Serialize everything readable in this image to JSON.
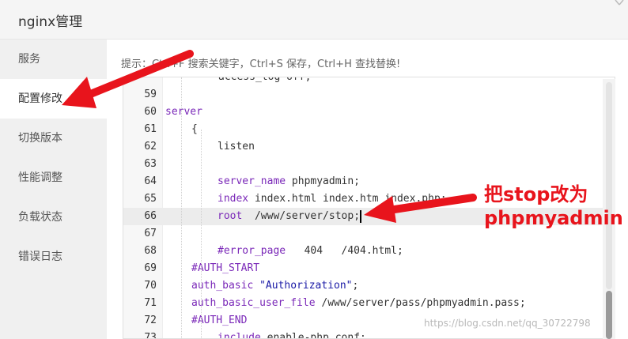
{
  "window": {
    "title": "nginx管理",
    "close_glyph": "⌐"
  },
  "sidebar": {
    "items": [
      {
        "label": "服务"
      },
      {
        "label": "配置修改"
      },
      {
        "label": "切换版本"
      },
      {
        "label": "性能调整"
      },
      {
        "label": "负载状态"
      },
      {
        "label": "错误日志"
      }
    ],
    "active_index": 1
  },
  "hint": "提示：Ctrl+F 搜索关键字，Ctrl+S 保存，Ctrl+H 查找替换!",
  "editor": {
    "partial_top_line": "access_log off;",
    "lines": [
      {
        "n": "59",
        "code": ""
      },
      {
        "n": "60",
        "code": "server"
      },
      {
        "n": "61",
        "code": "{"
      },
      {
        "n": "62",
        "code": "listen"
      },
      {
        "n": "63",
        "code": ""
      },
      {
        "n": "64",
        "code_kw": "server_name",
        "code_rest": " phpmyadmin;"
      },
      {
        "n": "65",
        "code_kw": "index",
        "code_rest": " index.html index.htm index.php;"
      },
      {
        "n": "66",
        "code_kw": "root",
        "code_rest": "  /www/server/stop;"
      },
      {
        "n": "67",
        "code": ""
      },
      {
        "n": "68",
        "code_kw": "#error_page",
        "code_rest": "   404   /404.html;"
      },
      {
        "n": "69",
        "code_kw": "#AUTH_START",
        "code_rest": ""
      },
      {
        "n": "70",
        "code_kw": "auth_basic",
        "code_str": " \"Authorization\"",
        "code_rest": ";"
      },
      {
        "n": "71",
        "code_kw": "auth_basic_user_file",
        "code_rest": " /www/server/pass/phpmyadmin.pass;"
      },
      {
        "n": "72",
        "code_kw": "#AUTH_END",
        "code_rest": ""
      },
      {
        "n": "73",
        "code_kw": "include",
        "code_rest": " enable-php.conf;"
      }
    ]
  },
  "annotation": {
    "line1": "把stop改为",
    "line2": "phpmyadmin"
  },
  "watermark": "https://blog.csdn.net/qq_30722798",
  "colors": {
    "arrow": "#e8141c",
    "active_line": "#ececec",
    "keyword": "#7a28b8"
  }
}
